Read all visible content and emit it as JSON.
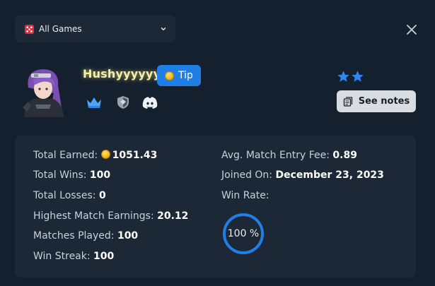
{
  "game_filter": {
    "selected": "All Games",
    "icon": "dice-icon"
  },
  "profile": {
    "username": "Hushyyyyyy",
    "tip_label": "Tip",
    "badges": [
      "crown-icon",
      "shield-icon",
      "discord-icon"
    ],
    "rating_stars": 2,
    "notes_label": "See notes"
  },
  "stats": {
    "total_earned_label": "Total Earned:",
    "total_earned": "1051.43",
    "total_wins_label": "Total Wins:",
    "total_wins": "100",
    "total_losses_label": "Total Losses:",
    "total_losses": "0",
    "highest_earnings_label": "Highest Match Earnings:",
    "highest_earnings": "20.12",
    "matches_played_label": "Matches Played:",
    "matches_played": "100",
    "win_streak_label": "Win Streak:",
    "win_streak": "100",
    "avg_fee_label": "Avg. Match Entry Fee:",
    "avg_fee": "0.89",
    "joined_label": "Joined On:",
    "joined": "December 23, 2023",
    "win_rate_label": "Win Rate:",
    "win_rate_text": "100 %",
    "win_rate_value": 1.0
  },
  "colors": {
    "background": "#15202e",
    "panel": "#1c2836",
    "accent": "#1f7fe6",
    "username_glow": "#f4efa9"
  }
}
